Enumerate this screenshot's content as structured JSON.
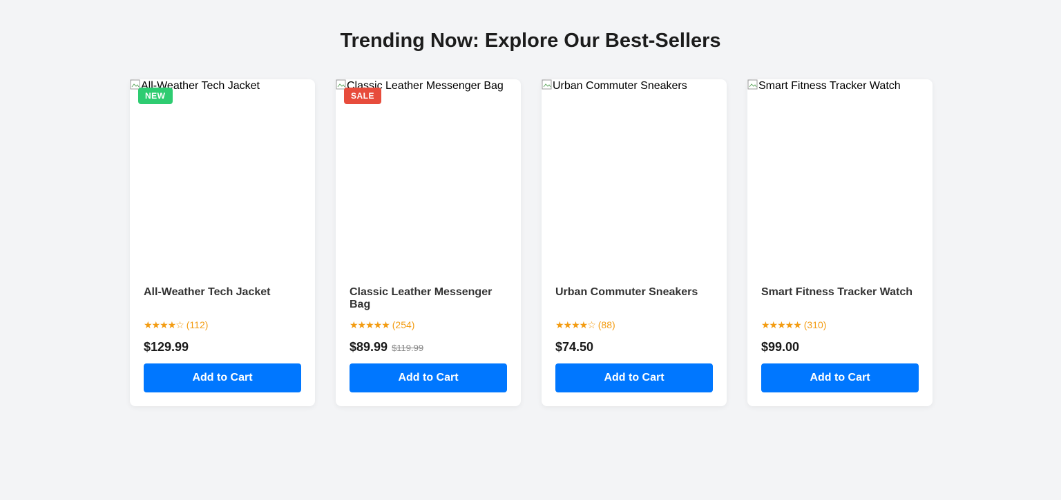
{
  "page": {
    "title": "Trending Now: Explore Our Best-Sellers"
  },
  "colors": {
    "background": "#f3f4f6",
    "card": "#ffffff",
    "button": "#0077ff",
    "star": "#f39c12",
    "badge_new": "#2ecc71",
    "badge_sale": "#e74c3c"
  },
  "products": [
    {
      "image_alt": "All-Weather Tech Jacket",
      "badge": "NEW",
      "badge_color": "#2ecc71",
      "name": "All-Weather Tech Jacket",
      "stars": "★★★★☆",
      "rating": 4,
      "review_count": "(112)",
      "price": "$129.99",
      "old_price": "",
      "button_label": "Add to Cart"
    },
    {
      "image_alt": "Classic Leather Messenger Bag",
      "badge": "SALE",
      "badge_color": "#e74c3c",
      "name": "Classic Leather Messenger Bag",
      "stars": "★★★★★",
      "rating": 5,
      "review_count": "(254)",
      "price": "$89.99",
      "old_price": "$119.99",
      "button_label": "Add to Cart"
    },
    {
      "image_alt": "Urban Commuter Sneakers",
      "badge": "",
      "badge_color": "",
      "name": "Urban Commuter Sneakers",
      "stars": "★★★★☆",
      "rating": 4,
      "review_count": "(88)",
      "price": "$74.50",
      "old_price": "",
      "button_label": "Add to Cart"
    },
    {
      "image_alt": "Smart Fitness Tracker Watch",
      "badge": "",
      "badge_color": "",
      "name": "Smart Fitness Tracker Watch",
      "stars": "★★★★★",
      "rating": 5,
      "review_count": "(310)",
      "price": "$99.00",
      "old_price": "",
      "button_label": "Add to Cart"
    }
  ]
}
